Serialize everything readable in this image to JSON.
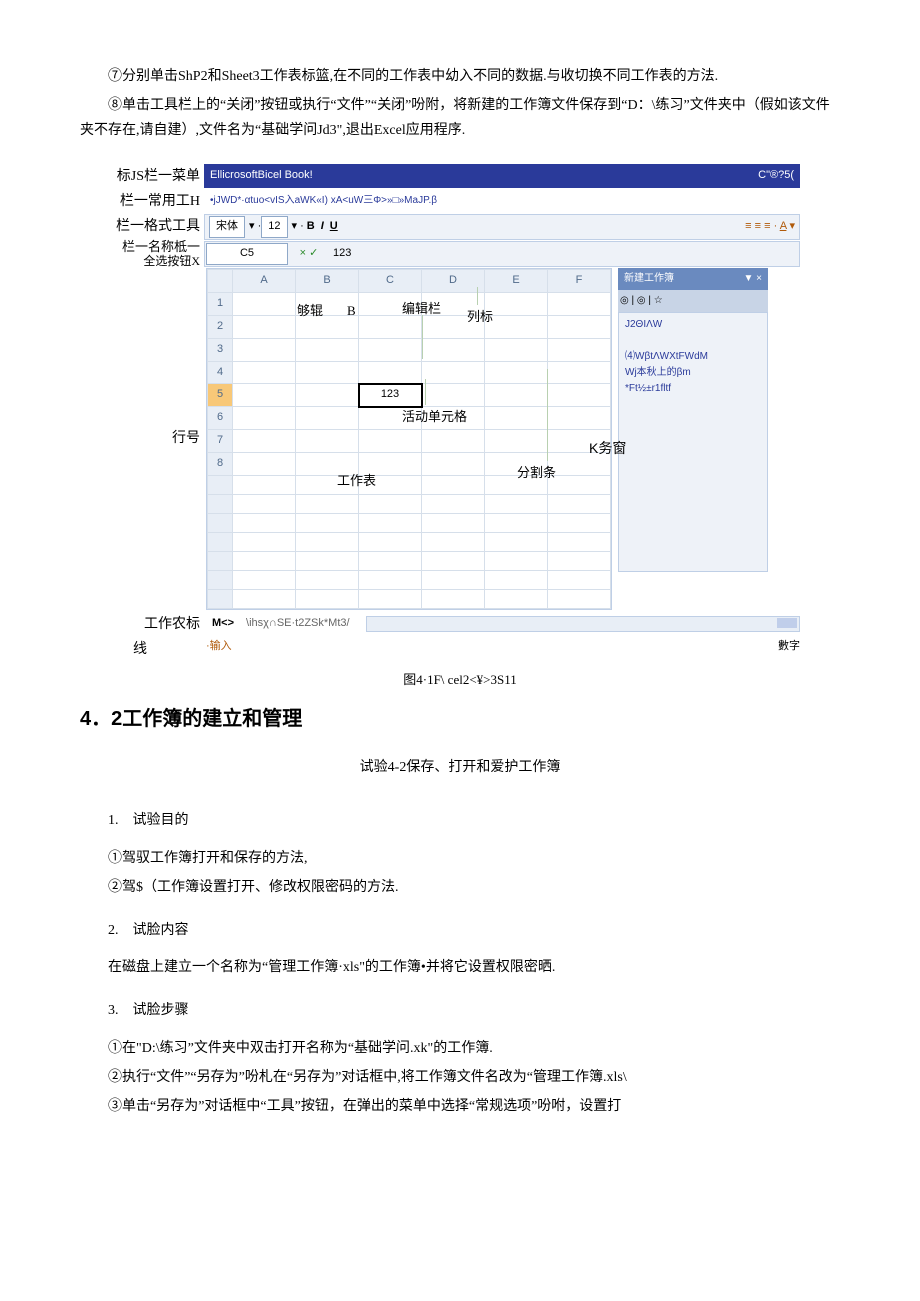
{
  "intro": {
    "p1": "⑦分别单击ShP2和Sheet3工作表标篮,在不同的工作表中幼入不同的数据.与收切换不同工作表的方法.",
    "p2": "⑧单击工具栏上的“关闭”按钮或执行“文件”“关闭”吩附，将新建的工作簿文件保存到“D：\\练习”文件夹中（假如该文件夹不存在,请自建）,文件名为“基础学问Jd3\",退出Excel应用程序."
  },
  "labels": {
    "titlebar": "标JS栏一菜单",
    "menubar": "栏一常用工H",
    "fmtbar": "栏一格式工具",
    "namebox": "栏一名称柢一",
    "selectall": "全选按钮X",
    "rownum": "行号",
    "tabline": "工作农标",
    "tabline2": "线",
    "gouku": "够辊",
    "colB": "B",
    "editbar": "编辑栏",
    "collabel": "列标",
    "activecell": "活动单元格",
    "wstab": "工作表",
    "splitter": "分割条",
    "taskpane": "K务窗"
  },
  "excel": {
    "title_left": "EllicrosoftBicel Book!",
    "title_right": "C\"®?5(",
    "menu": "•jJWD*·αtuo<vIS入aWK«I) xA<uW三Φ>»□»MaJP.β",
    "font": "宋体",
    "size": "12",
    "bold": "B",
    "italic": "I",
    "underline": "U",
    "namebox_val": "C5",
    "fx_icons": "× ✓",
    "fx_val": "123",
    "cols": [
      "",
      "A",
      "B",
      "C",
      "D",
      "E",
      "F"
    ],
    "rows": [
      "1",
      "2",
      "3",
      "4",
      "5",
      "6",
      "7",
      "8"
    ],
    "active_val": "123",
    "tabs_nav": "M<>",
    "tabs": "\\ihsχ∩SE·t2ZSk*Mt3/",
    "status": "·输入",
    "num_indicator": "數字",
    "taskpane_title": "新建工作簿",
    "taskpane_close": "▼ ×",
    "taskpane_tb": "◎ | ◎ | ☆",
    "tp1": "J2ΘIΛW",
    "tp2": "⑷WβtΛWXtFWdM",
    "tp3": "Wj本秋上的βm",
    "tp4": "*Ft½±r1fltf"
  },
  "caption": "图4·1F\\ cel2<¥>3S11",
  "section42": {
    "heading": "4．2工作簿的建立和管理",
    "subtitle": "试验4-2保存、打开和爱护工作簿",
    "item1": "1.　试验目的",
    "p1a": "①驾驭工作簿打开和保存的方法,",
    "p1b": "②驾$（工作簿设置打开、修改权限密码的方法.",
    "item2": "2.　试脸内容",
    "p2": "在磁盘上建立一个名称为“管理工作簿·xls\"的工作簿•并将它设置权限密晒.",
    "item3": "3.　试脸步骤",
    "p3a": "①在\"D:\\练习”文件夹中双击打开名称为“基础学问.xk\"的工作簿.",
    "p3b": "②执行“文件”“另存为”吩札在“另存为”对话框中,将工作簿文件名改为“管理工作簿.xls\\",
    "p3c": "③单击“另存为”对话框中“工具”按钮，在弹出的菜单中选择“常规选项”吩咐，设置打"
  }
}
